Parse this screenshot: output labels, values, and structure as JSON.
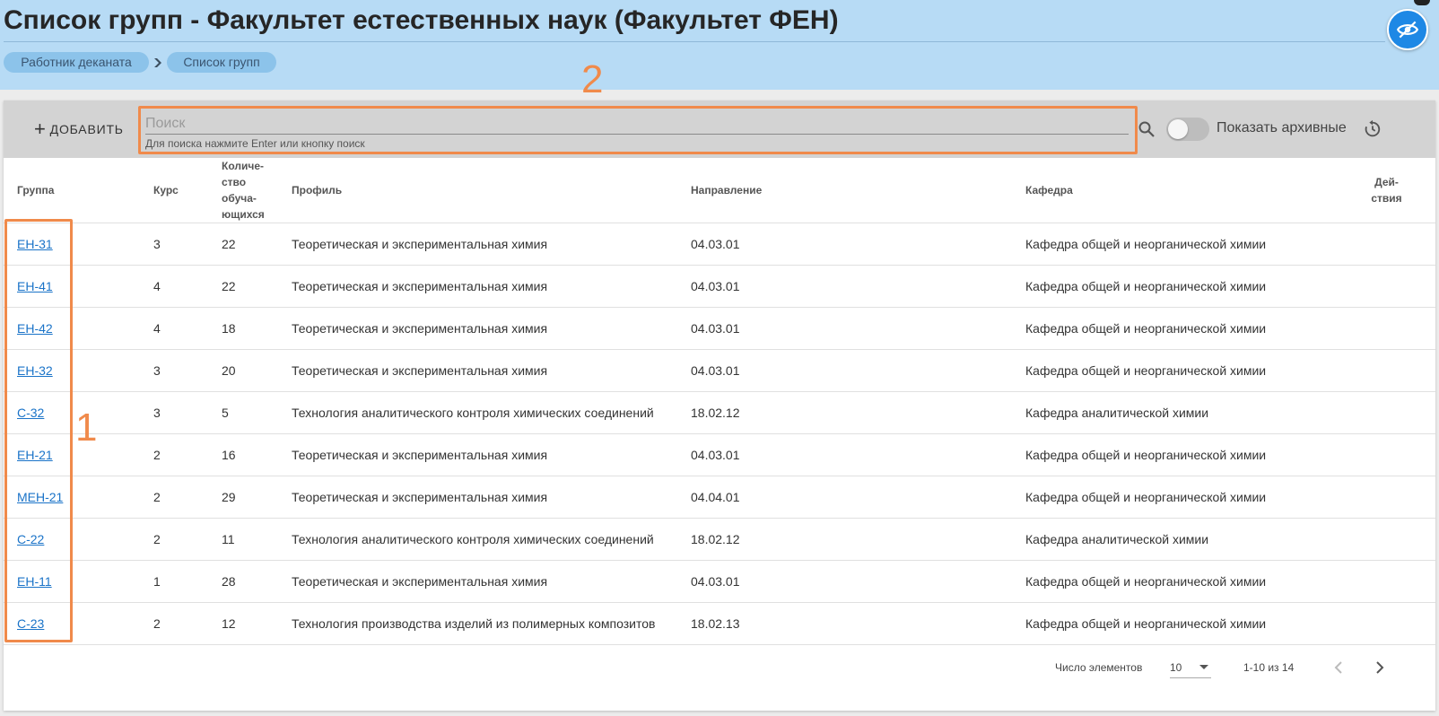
{
  "header": {
    "title": "Список групп - Факультет естественных наук (Факультет ФЕН)",
    "breadcrumbs": [
      "Работник деканата",
      "Список групп"
    ],
    "visibility_button_icon": "eye-off-icon"
  },
  "toolbar": {
    "add_label": "ДОБАВИТЬ",
    "search_placeholder": "Поиск",
    "search_value": "",
    "search_hint": "Для поиска нажмите Enter или кнопку поиск",
    "archive_toggle_label": "Показать архивные",
    "archive_toggle_on": false
  },
  "annotations": {
    "one": "1",
    "two": "2"
  },
  "table": {
    "headers": {
      "group": "Группа",
      "kurs": "Курс",
      "count": "Количе-ство обуча-ющихся",
      "profile": "Профиль",
      "direction": "Направление",
      "kafedra": "Кафедра",
      "actions": "Дей-ствия"
    },
    "rows": [
      {
        "group": "ЕН-31",
        "kurs": "3",
        "count": "22",
        "profile": "Теоретическая и экспериментальная химия",
        "direction": "04.03.01",
        "kafedra": "Кафедра общей и неорганической химии"
      },
      {
        "group": "ЕН-41",
        "kurs": "4",
        "count": "22",
        "profile": "Теоретическая и экспериментальная химия",
        "direction": "04.03.01",
        "kafedra": "Кафедра общей и неорганической химии"
      },
      {
        "group": "ЕН-42",
        "kurs": "4",
        "count": "18",
        "profile": "Теоретическая и экспериментальная химия",
        "direction": "04.03.01",
        "kafedra": "Кафедра общей и неорганической химии"
      },
      {
        "group": "ЕН-32",
        "kurs": "3",
        "count": "20",
        "profile": "Теоретическая и экспериментальная химия",
        "direction": "04.03.01",
        "kafedra": "Кафедра общей и неорганической химии"
      },
      {
        "group": "С-32",
        "kurs": "3",
        "count": "5",
        "profile": "Технология аналитического контроля химических соединений",
        "direction": "18.02.12",
        "kafedra": "Кафедра аналитической химии"
      },
      {
        "group": "ЕН-21",
        "kurs": "2",
        "count": "16",
        "profile": "Теоретическая и экспериментальная химия",
        "direction": "04.03.01",
        "kafedra": "Кафедра общей и неорганической химии"
      },
      {
        "group": "МЕН-21",
        "kurs": "2",
        "count": "29",
        "profile": "Теоретическая и экспериментальная химия",
        "direction": "04.04.01",
        "kafedra": "Кафедра общей и неорганической химии"
      },
      {
        "group": "С-22",
        "kurs": "2",
        "count": "11",
        "profile": "Технология аналитического контроля химических соединений",
        "direction": "18.02.12",
        "kafedra": "Кафедра аналитической химии"
      },
      {
        "group": "ЕН-11",
        "kurs": "1",
        "count": "28",
        "profile": "Теоретическая и экспериментальная химия",
        "direction": "04.03.01",
        "kafedra": "Кафедра общей и неорганической химии"
      },
      {
        "group": "С-23",
        "kurs": "2",
        "count": "12",
        "profile": "Технология производства изделий из полимерных композитов",
        "direction": "18.02.13",
        "kafedra": "Кафедра общей и неорганической химии"
      }
    ]
  },
  "footer": {
    "per_page_label": "Число элементов",
    "per_page_value": "10",
    "range": "1-10 из 14"
  },
  "colors": {
    "header_bg": "#b7dbf5",
    "breadcrumb_bg": "#8cc3ea",
    "accent": "#1e88e5",
    "annotation": "#f08a4b",
    "link": "#1a73c8"
  }
}
